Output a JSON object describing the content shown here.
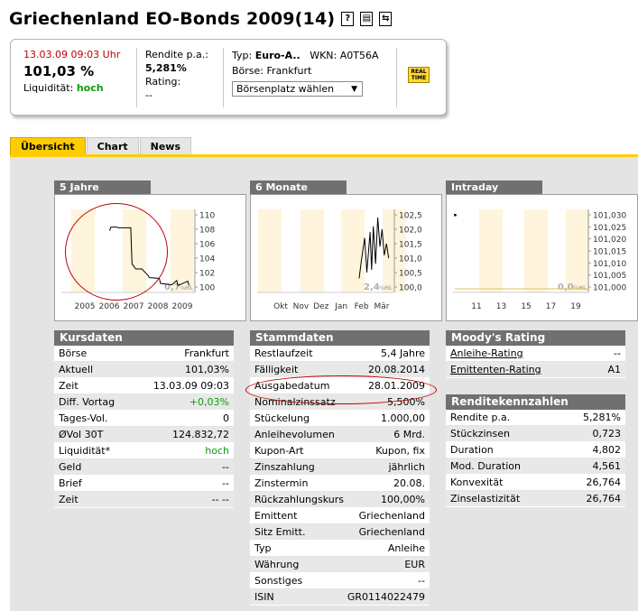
{
  "header": {
    "title": "Griechenland EO-Bonds 2009(14)",
    "icons": [
      "help-icon",
      "print-icon",
      "swap-icon"
    ],
    "icon_glyphs": [
      "?",
      "▤",
      "⇆"
    ]
  },
  "quote": {
    "datetime": "13.03.09  09:03 Uhr",
    "price": "101,03 %",
    "liquidity_label": "Liquidität:",
    "liquidity_value": "hoch",
    "yield_label": "Rendite p.a.:",
    "yield_value": "5,281%",
    "rating_label": "Rating:",
    "rating_value": "--",
    "type_label": "Typ:",
    "type_value": "Euro-A..",
    "wkn_label": "WKN:",
    "wkn_value": "A0T56A",
    "exchange_label": "Börse:",
    "exchange_value": "Frankfurt",
    "exchange_select": "Börsenplatz wählen",
    "realtime_badge": [
      "REAL",
      "TIME"
    ]
  },
  "tabs": [
    {
      "label": "Übersicht",
      "active": true
    },
    {
      "label": "Chart",
      "active": false
    },
    {
      "label": "News",
      "active": false
    }
  ],
  "charts": [
    {
      "label": "5 Jahre",
      "type": "line",
      "x_labels": [
        "2005",
        "2006",
        "2007",
        "2008",
        "2009"
      ],
      "y_labels": [
        "110",
        "108",
        "106",
        "104",
        "102",
        "100"
      ],
      "ylim": [
        100,
        110
      ],
      "watermark": "0,7",
      "watermark_small": "%HL",
      "x": [
        2006.0,
        2006.05,
        2006.3,
        2006.35,
        2006.85,
        2006.9,
        2007.05,
        2007.3,
        2007.55,
        2007.6,
        2008.0,
        2008.05,
        2008.5,
        2008.7,
        2008.75,
        2009.15,
        2009.2
      ],
      "y": [
        107.8,
        108.3,
        108.3,
        108.2,
        108.2,
        103.2,
        102.5,
        102.5,
        101.6,
        101.3,
        101.2,
        100.5,
        100.3,
        100.9,
        100.2,
        100.8,
        100.2
      ]
    },
    {
      "label": "6 Monate",
      "type": "line",
      "x_labels": [
        "Okt",
        "Nov",
        "Dez",
        "Jan",
        "Feb",
        "Mär"
      ],
      "y_labels": [
        "102,5",
        "102,0",
        "101,5",
        "101,0",
        "100,5",
        "100,0"
      ],
      "ylim": [
        100,
        102.5
      ],
      "watermark": "2,4",
      "watermark_small": "%HL",
      "x": [
        4.05,
        4.15,
        4.3,
        4.4,
        4.55,
        4.62,
        4.7,
        4.8,
        4.9,
        5.0,
        5.1,
        5.2,
        5.3,
        5.4
      ],
      "y": [
        100.3,
        100.9,
        101.7,
        100.5,
        101.9,
        100.6,
        102.1,
        100.8,
        102.4,
        101.4,
        102.0,
        101.1,
        101.5,
        101.0
      ]
    },
    {
      "label": "Intraday",
      "type": "line",
      "x_labels": [
        "11",
        "13",
        "15",
        "17",
        "19"
      ],
      "y_labels": [
        "101,030",
        "101,025",
        "101,020",
        "101,015",
        "101,010",
        "101,005",
        "101,000"
      ],
      "ylim": [
        101.0,
        101.03
      ],
      "watermark": "0,0",
      "watermark_small": "%HL",
      "x": [
        9.05
      ],
      "y": [
        101.03
      ]
    }
  ],
  "kursdaten": {
    "title": "Kursdaten",
    "rows": [
      {
        "label": "Börse",
        "value": "Frankfurt"
      },
      {
        "label": "Aktuell",
        "value": "101,03%"
      },
      {
        "label": "Zeit",
        "value": "13.03.09  09:03"
      },
      {
        "label": "Diff. Vortag",
        "value": "+0,03%",
        "color": "#109a10"
      },
      {
        "label": "Tages-Vol.",
        "value": "0"
      },
      {
        "label": "ØVol 30T",
        "value": "124.832,72"
      },
      {
        "label": "Liquidität*",
        "value": "hoch",
        "color": "#109a10"
      },
      {
        "label": "Geld",
        "value": "--"
      },
      {
        "label": "Brief",
        "value": "--"
      },
      {
        "label": "Zeit",
        "value": "--  --"
      }
    ]
  },
  "stammdaten": {
    "title": "Stammdaten",
    "rows": [
      {
        "label": "Restlaufzeit",
        "value": "5,4 Jahre"
      },
      {
        "label": "Fälligkeit",
        "value": "20.08.2014"
      },
      {
        "label": "Ausgabedatum",
        "value": "28.01.2009"
      },
      {
        "label": "Nominalzinssatz",
        "value": "5,500%"
      },
      {
        "label": "Stückelung",
        "value": "1.000,00"
      },
      {
        "label": "Anleihevolumen",
        "value": "6 Mrd."
      },
      {
        "label": "Kupon-Art",
        "value": "Kupon, fix"
      },
      {
        "label": "Zinszahlung",
        "value": "jährlich"
      },
      {
        "label": "Zinstermin",
        "value": "20.08."
      },
      {
        "label": "Rückzahlungskurs",
        "value": "100,00%"
      },
      {
        "label": "Emittent",
        "value": "Griechenland"
      },
      {
        "label": "Sitz Emitt.",
        "value": "Griechenland"
      },
      {
        "label": "Typ",
        "value": "Anleihe"
      },
      {
        "label": "Währung",
        "value": "EUR"
      },
      {
        "label": "Sonstiges",
        "value": "--"
      },
      {
        "label": "ISIN",
        "value": "GR0114022479"
      }
    ]
  },
  "moodys": {
    "title": "Moody's Rating",
    "rows": [
      {
        "label": "Anleihe-Rating",
        "value": "--"
      },
      {
        "label": "Emittenten-Rating",
        "value": "A1"
      }
    ]
  },
  "rendite": {
    "title": "Renditekennzahlen",
    "rows": [
      {
        "label": "Rendite p.a.",
        "value": "5,281%"
      },
      {
        "label": "Stückzinsen",
        "value": "0,723"
      },
      {
        "label": "Duration",
        "value": "4,802"
      },
      {
        "label": "Mod. Duration",
        "value": "4,561"
      },
      {
        "label": "Konvexität",
        "value": "26,764"
      },
      {
        "label": "Zinselastizität",
        "value": "26,764"
      }
    ]
  },
  "annotation_color": "#c00000"
}
